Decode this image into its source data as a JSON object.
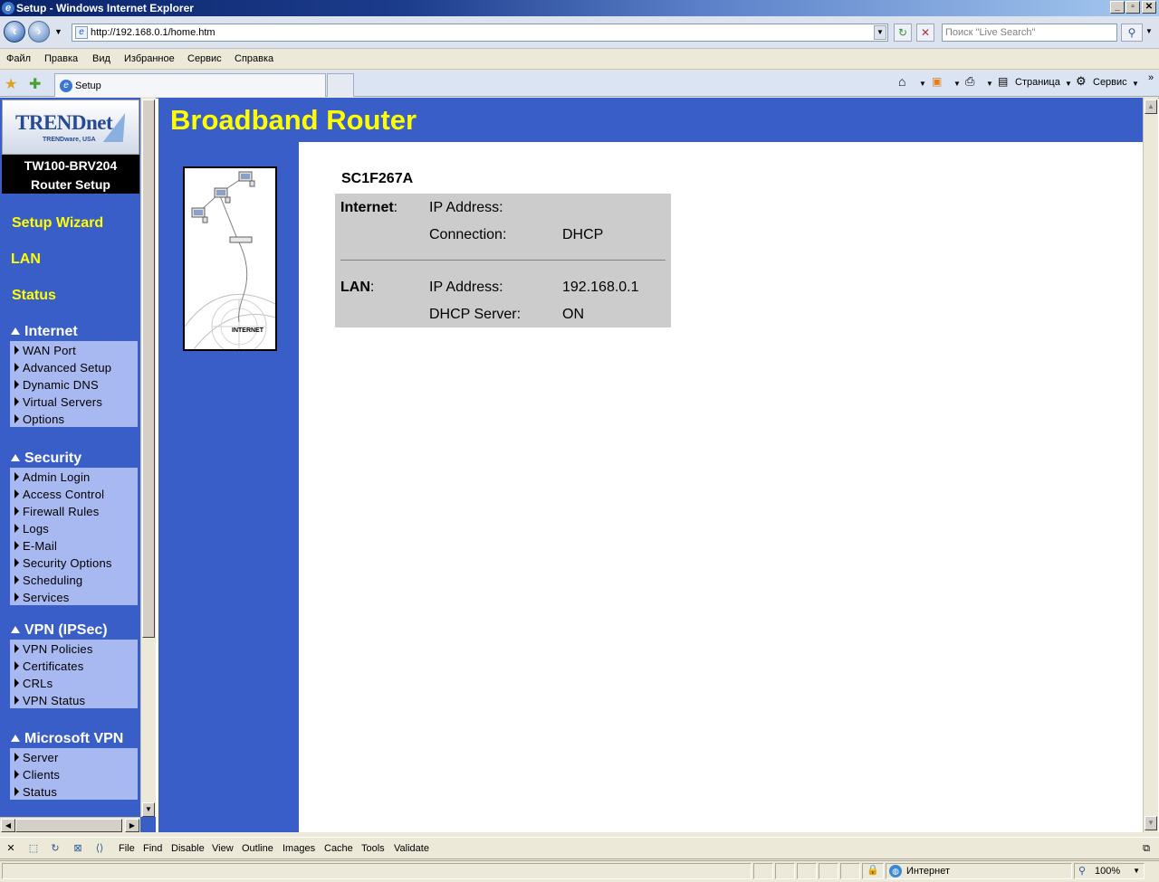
{
  "window": {
    "title": "Setup - Windows Internet Explorer",
    "controls": [
      "_",
      "▫",
      "✕"
    ]
  },
  "address_bar": {
    "url": "http://192.168.0.1/home.htm",
    "search_placeholder": "Поиск \"Live Search\""
  },
  "menu": [
    "Файл",
    "Правка",
    "Вид",
    "Избранное",
    "Сервис",
    "Справка"
  ],
  "tabs": {
    "active": "Setup"
  },
  "command_bar": {
    "page": "Страница",
    "tools": "Сервис"
  },
  "sidebar": {
    "brand": "TRENDnet",
    "brand_sub": "TRENDware, USA",
    "model": "TW100-BRV204",
    "model_sub": "Router Setup",
    "links": [
      "Setup Wizard",
      "LAN",
      "Status"
    ],
    "sections": [
      {
        "title": "Internet",
        "items": [
          "WAN Port",
          "Advanced Setup",
          "Dynamic DNS",
          "Virtual Servers",
          "Options"
        ]
      },
      {
        "title": "Security",
        "items": [
          "Admin Login",
          "Access Control",
          "Firewall Rules",
          "Logs",
          "E-Mail",
          "Security Options",
          "Scheduling",
          "Services"
        ]
      },
      {
        "title": "VPN (IPSec)",
        "items": [
          "VPN Policies",
          "Certificates",
          "CRLs",
          "VPN Status"
        ]
      },
      {
        "title": "Microsoft VPN",
        "items": [
          "Server",
          "Clients",
          "Status"
        ]
      }
    ]
  },
  "main": {
    "header": "Broadband Router",
    "picture_label": "INTERNET",
    "device_name": "SC1F267A",
    "internet": {
      "label": "Internet",
      "colon": ":",
      "ip_label": "IP Address:",
      "ip_value": "",
      "conn_label": "Connection:",
      "conn_value": "DHCP"
    },
    "lan": {
      "label": "LAN",
      "colon": ":",
      "ip_label": "IP Address:",
      "ip_value": "192.168.0.1",
      "dhcp_label": "DHCP Server:",
      "dhcp_value": "ON"
    }
  },
  "dev_toolbar": [
    "File",
    "Find",
    "Disable",
    "View",
    "Outline",
    "Images",
    "Cache",
    "Tools",
    "Validate"
  ],
  "status_bar": {
    "zone": "Интернет",
    "zoom": "100%"
  }
}
